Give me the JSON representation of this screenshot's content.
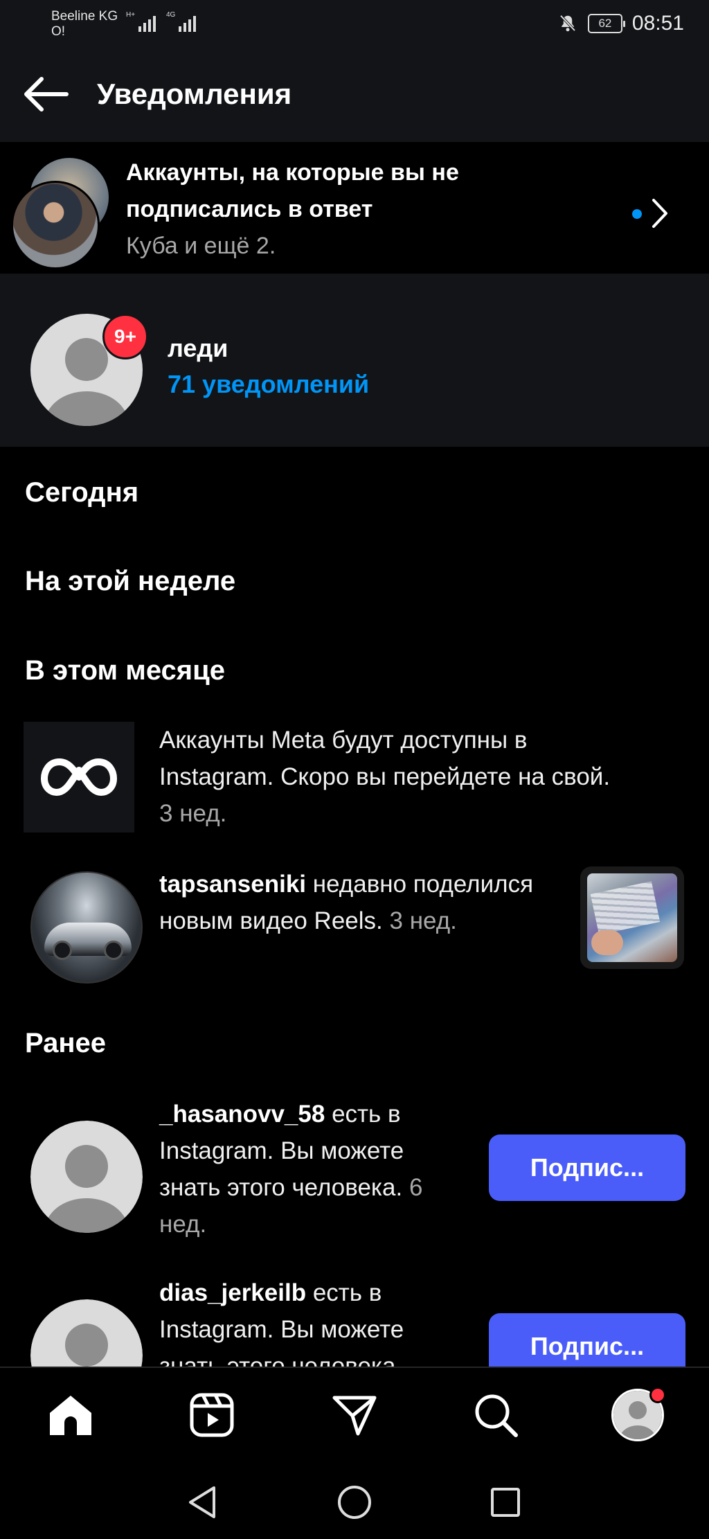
{
  "status_bar": {
    "carrier_line1": "Beeline KG",
    "carrier_line2": "O!",
    "net_type_1": "H+",
    "net_type_2": "4G",
    "battery": "62",
    "time": "08:51"
  },
  "header": {
    "title": "Уведомления"
  },
  "follow_requests": {
    "title": "Аккаунты, на которые вы не подписались в ответ",
    "subtitle": "Куба и ещё 2."
  },
  "account": {
    "badge": "9+",
    "name": "леди",
    "notifications": "71 уведомлений"
  },
  "sections": {
    "today": "Сегодня",
    "this_week": "На этой неделе",
    "this_month": "В этом месяце",
    "earlier": "Ранее"
  },
  "notifications": [
    {
      "text": "Аккаунты Meta будут доступны в Instagram. Скоро вы перейдете на свой.",
      "time": "3 нед."
    },
    {
      "username": "tapsanseniki",
      "text": "недавно поделился новым видео Reels.",
      "time": "3 нед."
    },
    {
      "username": "_hasanovv_58",
      "text": "есть в Instagram. Вы можете знать этого человека.",
      "time": "6 нед.",
      "button": "Подпис..."
    },
    {
      "username": "dias_jerkeilb",
      "text": "есть в Instagram. Вы можете знать этого человека.",
      "button": "Подпис..."
    }
  ],
  "colors": {
    "accent_blue": "#0095f6",
    "follow_button": "#4a5df9",
    "badge_red": "#ff3040",
    "card_bg": "#121417"
  },
  "bottom_nav": {
    "icons": [
      "home-icon",
      "reels-icon",
      "direct-icon",
      "search-icon",
      "profile-icon"
    ]
  },
  "system_nav": {
    "icons": [
      "back-triangle-icon",
      "home-circle-icon",
      "recents-square-icon"
    ]
  }
}
